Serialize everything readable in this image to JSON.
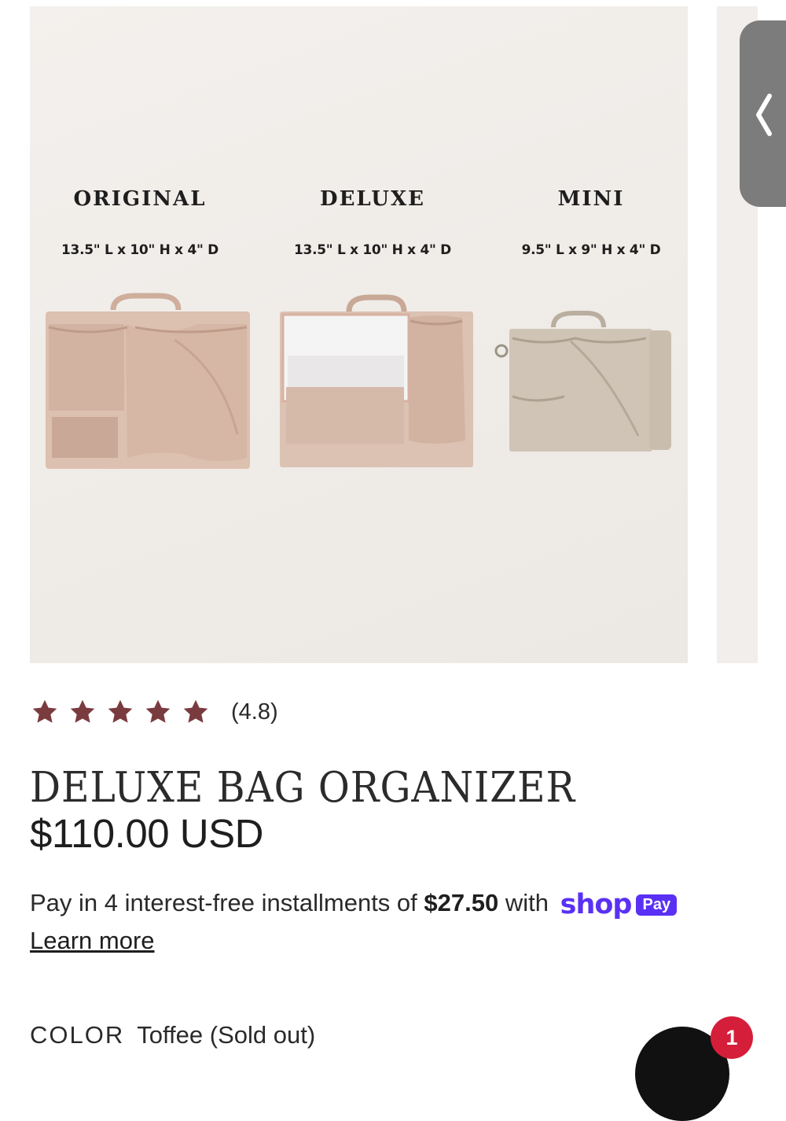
{
  "gallery": {
    "variants": [
      {
        "name": "ORIGINAL",
        "dims": "13.5\" L x 10\" H x 4\" D"
      },
      {
        "name": "DELUXE",
        "dims": "13.5\" L x 10\" H x 4\" D"
      },
      {
        "name": "MINI",
        "dims": "9.5\" L x 9\" H x 4\" D"
      }
    ]
  },
  "product": {
    "rating_stars": 5,
    "rating_value": "(4.8)",
    "title": "DELUXE BAG ORGANIZER",
    "price": "$110.00 USD",
    "installments_prefix": "Pay in 4 interest-free installments of",
    "installment_amount": "$27.50",
    "installments_suffix": "with",
    "shop_pay_word": "shop",
    "shop_pay_badge": "Pay",
    "learn_more": "Learn more",
    "color_label": "COLOR",
    "color_value": "Toffee (Sold out)"
  },
  "cart": {
    "count": "1"
  },
  "colors": {
    "star": "#7a3b3f",
    "shop_pay": "#5a31f4",
    "cart_badge": "#d51e3a",
    "bag": "#dcc0b0",
    "mini_bag": "#cfc4b6"
  },
  "icons": {
    "nav": "chevron-left-icon",
    "rating": "star-icon",
    "cart": "cart-icon"
  }
}
